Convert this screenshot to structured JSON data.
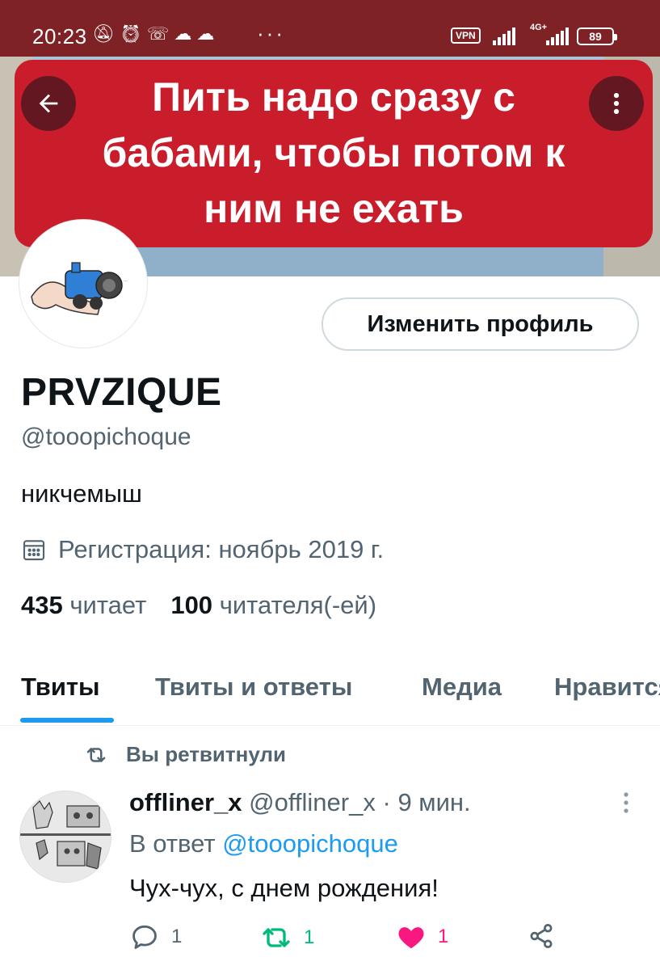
{
  "status_bar": {
    "time": "20:23",
    "notification_icons": [
      "mute-icon",
      "alarm-icon",
      "missed-call-icon",
      "cloud-icon",
      "cloud-sync-icon"
    ],
    "more": "···",
    "vpn": "VPN",
    "network": "4G+",
    "battery": "89"
  },
  "banner": {
    "text_lines": [
      "Пить надо сразу с",
      "бабами, чтобы потом к",
      "ним не ехать"
    ]
  },
  "profile": {
    "edit_button": "Изменить профиль",
    "name": "PRVZIQUE",
    "handle": "@tooopichoque",
    "bio": "никчемыш",
    "registration": "Регистрация: ноябрь 2019 г.",
    "following_count": "435",
    "following_label": "читает",
    "followers_count": "100",
    "followers_label": "читателя(-ей)"
  },
  "tabs": [
    {
      "label": "Твиты",
      "active": true
    },
    {
      "label": "Твиты и ответы",
      "active": false
    },
    {
      "label": "Медиа",
      "active": false
    },
    {
      "label": "Нравится",
      "active": false
    }
  ],
  "tweet": {
    "retweet_label": "Вы ретвитнули",
    "author_name": "offliner_x",
    "author_handle": "@offliner_x",
    "separator": "·",
    "time": "9 мин.",
    "reply_prefix": "В ответ",
    "reply_mention": "@tooopichoque",
    "text": "Чух-чух, с днем рождения!",
    "reply_count": "1",
    "retweet_count": "1",
    "like_count": "1"
  },
  "colors": {
    "status_bar": "#7f2225",
    "banner_red": "#c91d2b",
    "accent": "#1d9bf0",
    "retweet_green": "#00ba7c",
    "like_pink": "#f91880",
    "secondary_text": "#536471"
  }
}
